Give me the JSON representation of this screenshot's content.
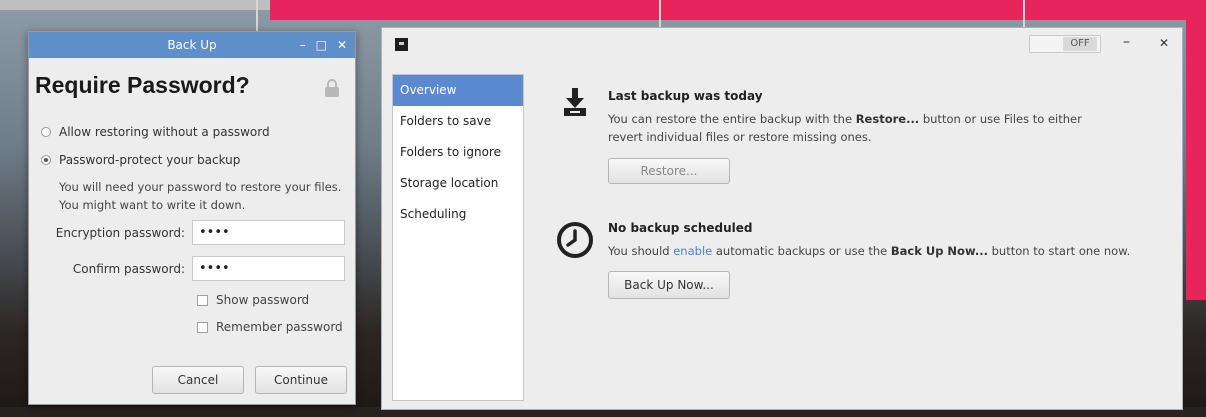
{
  "dialog": {
    "title": "Back Up",
    "controls": {
      "minimize": "–",
      "maximize": "□",
      "close": "✕"
    },
    "heading": "Require Password?",
    "radio_no_password": "Allow restoring without a password",
    "radio_password": "Password-protect your backup",
    "hint_line1": "You will need your password to restore your files.",
    "hint_line2": "You might want to write it down.",
    "encryption_label": "Encryption password:",
    "encryption_value": "••••",
    "confirm_label": "Confirm password:",
    "confirm_value": "••••",
    "show_password": "Show password",
    "remember_password": "Remember password",
    "cancel_button": "Cancel",
    "continue_button": "Continue"
  },
  "main": {
    "toggle_label": "OFF",
    "controls": {
      "minimize": "–",
      "close": "✕"
    },
    "sidebar": [
      {
        "label": "Overview"
      },
      {
        "label": "Folders to save"
      },
      {
        "label": "Folders to ignore"
      },
      {
        "label": "Storage location"
      },
      {
        "label": "Scheduling"
      }
    ],
    "backup_section": {
      "title": "Last backup was today",
      "text_prefix": "You can restore the entire backup with the ",
      "text_bold": "Restore...",
      "text_suffix": " button or use Files to either",
      "text_line2": "revert individual files or restore missing ones.",
      "button": "Restore..."
    },
    "schedule_section": {
      "title": "No backup scheduled",
      "text_prefix": "You should ",
      "text_link": "enable",
      "text_middle": " automatic backups or use the ",
      "text_bold": "Back Up Now...",
      "text_suffix": " button to start one now.",
      "button": "Back Up Now..."
    }
  },
  "colors": {
    "accent_blue": "#5b8ad1",
    "title_blue": "#5f8fc9",
    "frame_pink": "#e8245c"
  }
}
